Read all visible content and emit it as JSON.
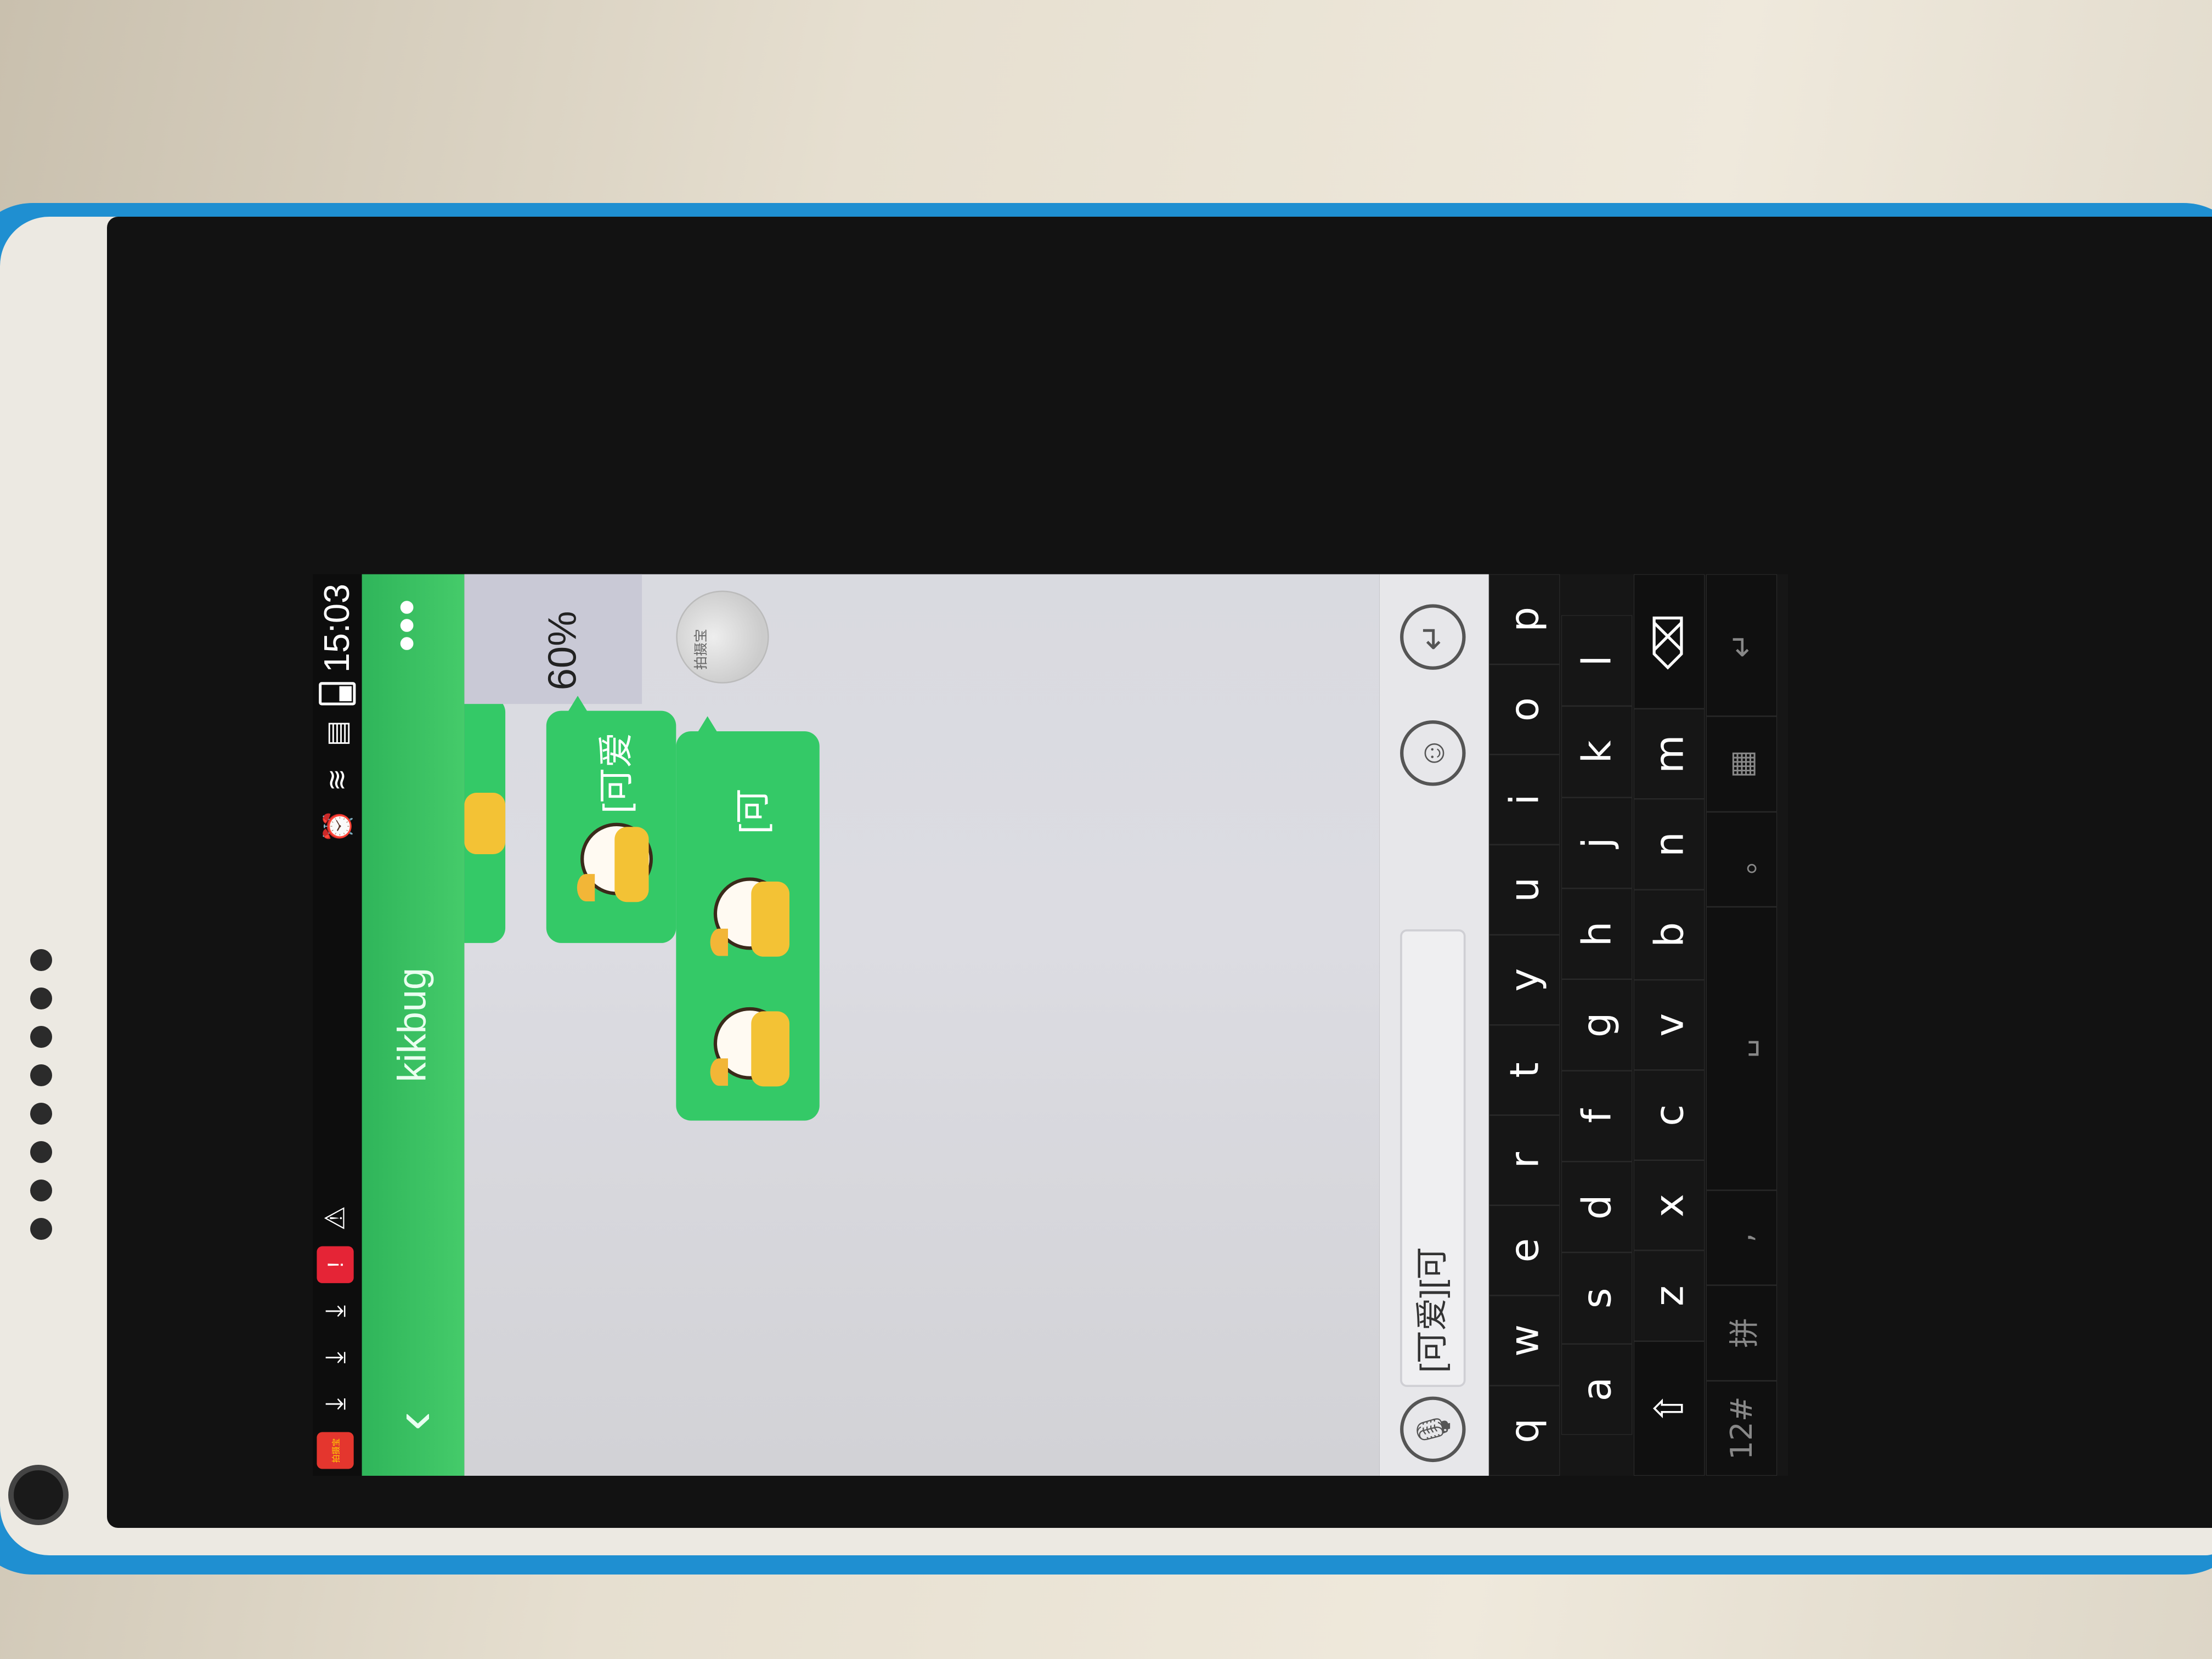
{
  "status_bar": {
    "time": "15:03",
    "left_icons": [
      "app-badge-icon",
      "download-icon",
      "download-icon",
      "download-icon",
      "alert-icon",
      "wifi-warning-icon"
    ],
    "right_icons": [
      "alarm-icon",
      "wifi-icon",
      "sim-icon",
      "battery-icon"
    ],
    "app_badge_text": "拍摄宝"
  },
  "header": {
    "title": "kikbug",
    "back_glyph": "‹",
    "more_glyph": "•••"
  },
  "chat": {
    "messages": [
      {
        "type": "partial-sticker"
      },
      {
        "type": "sticker",
        "text": "[可爱",
        "progress": "60%",
        "avatar_label": "拍摄宝"
      },
      {
        "type": "sticker",
        "text": "[可",
        "avatar_label": "拍摄宝"
      }
    ]
  },
  "input_bar": {
    "voice_glyph": "🎙",
    "text_value": "[可爱][可",
    "emoji_glyph": "☺",
    "send_glyph": "↵"
  },
  "keyboard": {
    "row1": [
      "q",
      "w",
      "e",
      "r",
      "t",
      "y",
      "u",
      "i",
      "o",
      "p"
    ],
    "row2": [
      "a",
      "s",
      "d",
      "f",
      "g",
      "h",
      "j",
      "k",
      "l"
    ],
    "row3": [
      "z",
      "x",
      "c",
      "v",
      "b",
      "n",
      "m"
    ],
    "row4": {
      "symbols": "12#",
      "pinyin": "拼",
      "comma": ",",
      "space": "␣",
      "period": "。"
    },
    "top_mic_glyph": "🎙"
  }
}
